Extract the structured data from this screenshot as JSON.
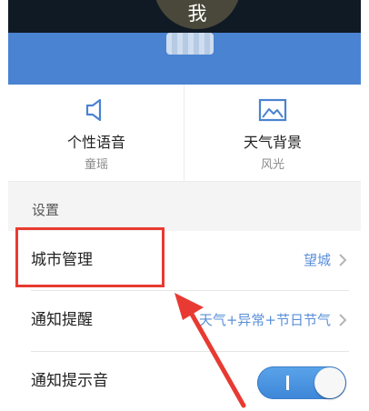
{
  "header": {
    "avatar_title": "我"
  },
  "features": [
    {
      "title": "个性语音",
      "subtitle": "童瑶",
      "icon": "speaker-icon"
    },
    {
      "title": "天气背景",
      "subtitle": "风光",
      "icon": "image-icon"
    }
  ],
  "settings": {
    "section_label": "设置",
    "rows": [
      {
        "label": "城市管理",
        "value": "望城"
      },
      {
        "label": "通知提醒",
        "value": "天气+异常+节日节气"
      },
      {
        "label": "通知提示音",
        "toggle_on": true
      }
    ]
  },
  "colors": {
    "accent": "#4a83d1",
    "value_text": "#5a8fd8",
    "annotation": "#e83a32",
    "toggle": "#3d86d8"
  }
}
